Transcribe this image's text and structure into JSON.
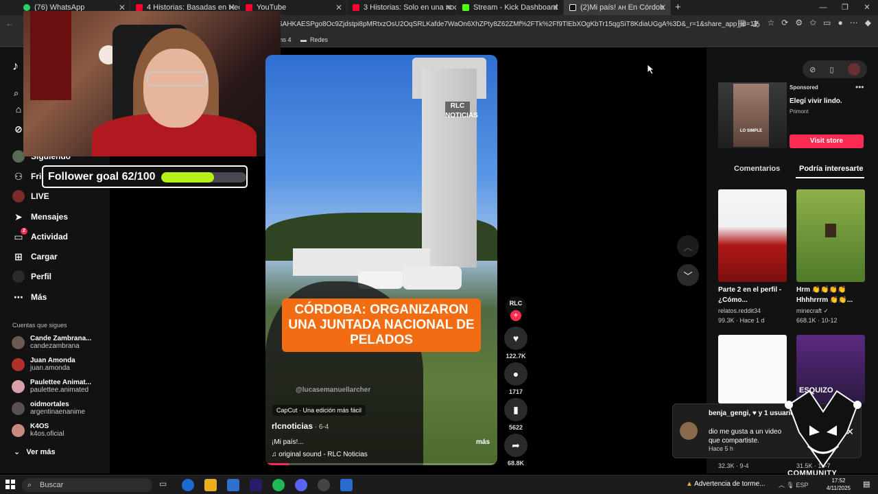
{
  "browser": {
    "tabs": [
      {
        "title": "(76) WhatsApp",
        "color": "#25d366"
      },
      {
        "title": "4 Historias: Basadas en Hechos Re",
        "color": "#ff0033"
      },
      {
        "title": "YouTube",
        "color": "#ff0033"
      },
      {
        "title": "3 Historias: Solo en una noche Il",
        "color": "#ff0033"
      },
      {
        "title": "Stream - Kick Dashboard",
        "color": "#53fc18"
      },
      {
        "title": "(2)Mi país! ᴀʜ En Córdob",
        "color": "#ffffff"
      }
    ],
    "url": "SAHKAESPgo8Oc9Zjdstpi8pMRtxzOsU2OqSRLKafde7WaOn6XhZPty8Z62ZMf%2FTk%2Ff9TlEbXOgKbTr15qgSiT8KdiaUGgA%3D&_r=1&share_app_id=1233...",
    "bookmarks": [
      "ms 4",
      "Redes"
    ]
  },
  "sidebar": {
    "items": [
      {
        "label": "Siguiendo",
        "icon": "avatar-icon"
      },
      {
        "label": "Friends",
        "icon": "friends-icon"
      },
      {
        "label": "LIVE",
        "icon": "live-icon"
      },
      {
        "label": "Mensajes",
        "icon": "messages-icon"
      },
      {
        "label": "Actividad",
        "icon": "activity-icon",
        "badge": "2"
      },
      {
        "label": "Cargar",
        "icon": "upload-icon"
      },
      {
        "label": "Perfil",
        "icon": "profile-icon"
      },
      {
        "label": "Más",
        "icon": "more-icon"
      }
    ],
    "following_title": "Cuentas que sigues",
    "following": [
      {
        "name": "Cande Zambrana...",
        "user": "candezambrana"
      },
      {
        "name": "Juan Amonda",
        "user": "juan.amonda"
      },
      {
        "name": "Paulettee Animat...",
        "user": "paulettee.animated"
      },
      {
        "name": "oidmortales",
        "user": "argentinaenanime"
      },
      {
        "name": "K4OS",
        "user": "k4os.oficial"
      }
    ],
    "see_more": "Ver más"
  },
  "overlay": {
    "goal_label": "Follower goal 62/100",
    "goal_progress": 0.62,
    "goal_color": "#b6f018"
  },
  "video": {
    "headline": "CÓRDOBA: ORGANIZARON UNA JUNTADA NACIONAL DE PELADOS",
    "tag": "RLC NOTICIAS",
    "watermark": "@lucasemanuellarcher",
    "capcut": "CapCut · Una edición más fácil",
    "author": "rlcnoticias",
    "date": " · 6-4",
    "description": "¡Mi país!...",
    "more": "más",
    "sound": "♫  original sound - RLC Noticias",
    "progress": 0.1
  },
  "actions": {
    "avatar_label": "RLC",
    "likes": "122.7K",
    "comments": "1717",
    "saves": "5622",
    "shares": "68.8K"
  },
  "right": {
    "sponsored": "Sponsored",
    "ad_title": "Elegí vivir lindo.",
    "ad_brand": "Primont",
    "ad_img_text": "LO SIMPLE",
    "visit": "Visit store",
    "tab_comments": "Comentarios",
    "tab_interest": "Podría interesarte",
    "cards": [
      {
        "caption": "Parte 2 en el perfil - ¿Cómo...",
        "author": "relatos.reddit34",
        "meta": "99.3K · Hace 1 d"
      },
      {
        "caption": "Hrm 👏👏👏👏 Hhhhrrrm 👏👏...",
        "author": "minecraft ✓",
        "meta": "668.1K · 10-12"
      }
    ],
    "bottom_meta": [
      "32.3K · 9-4",
      "31.5K · 10-7"
    ]
  },
  "notification": {
    "title": "benja_gengi, ♥ y 1 usuarios más",
    "body": "dio me gusta a un video que compartiste.",
    "time": "Hace 5 h"
  },
  "branding": {
    "esquizo": "ESQUIZO",
    "community": "COMMUNITY"
  },
  "taskbar": {
    "search_placeholder": "Buscar",
    "weather": "Advertencia de torme...",
    "lang": "ESP",
    "time": "17:52",
    "date": "4/11/2025"
  }
}
